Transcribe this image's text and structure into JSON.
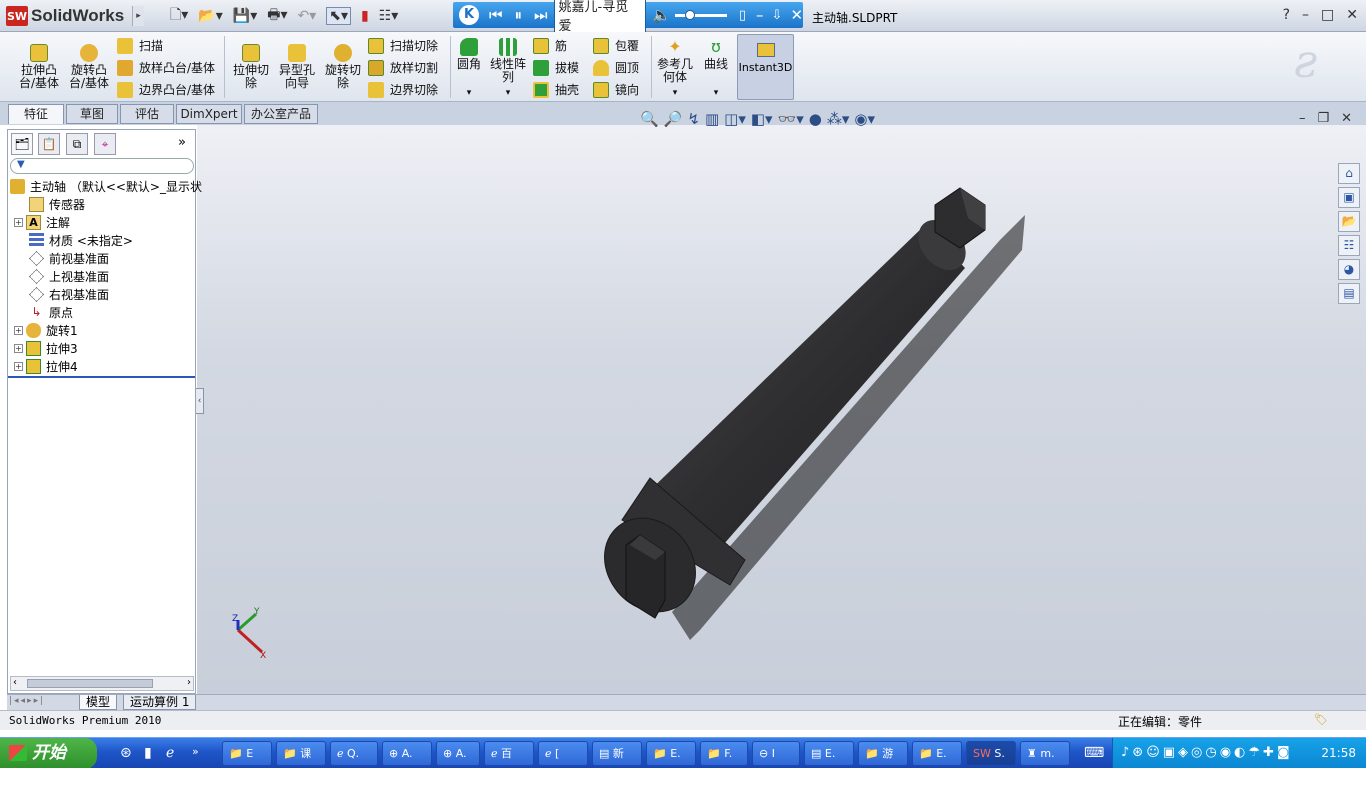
{
  "app": {
    "brand_badge": "SW",
    "brand": "SolidWorks",
    "document_title": "主动轴.SLDPRT",
    "help": "?",
    "min": "–",
    "max": "□",
    "close": "✕"
  },
  "media": {
    "song": "姚嘉儿-寻觅爱",
    "logo": "K",
    "prev": "⏮",
    "pause": "⏸",
    "next": "⏭"
  },
  "ribbon": {
    "extrude_boss": "拉伸凸台/基体",
    "revolve_boss": "旋转凸台/基体",
    "sweep": "扫描",
    "loft_boss": "放样凸台/基体",
    "boundary_boss": "边界凸台/基体",
    "extrude_cut": "拉伸切除",
    "hole_wizard": "异型孔向导",
    "revolve_cut": "旋转切除",
    "sweep_cut": "扫描切除",
    "loft_cut": "放样切割",
    "boundary_cut": "边界切除",
    "fillet": "圆角",
    "linear_pattern": "线性阵列",
    "rib": "筋",
    "draft": "拔模",
    "shell": "抽壳",
    "wrap": "包覆",
    "dome": "圆顶",
    "mirror": "镜向",
    "ref_geometry": "参考几何体",
    "curves": "曲线",
    "instant3d": "Instant3D"
  },
  "tabs": [
    "特征",
    "草图",
    "评估",
    "DimXpert",
    "办公室产品"
  ],
  "tree": {
    "root": "主动轴 （默认<<默认>_显示状",
    "items": [
      "传感器",
      "注解",
      "材质 <未指定>",
      "前视基准面",
      "上视基准面",
      "右视基准面",
      "原点",
      "旋转1",
      "拉伸3",
      "拉伸4"
    ]
  },
  "bottom_tabs": [
    "模型",
    "运动算例 1"
  ],
  "status": {
    "left": "SolidWorks Premium 2010",
    "right": "正在编辑：零件"
  },
  "triad": {
    "x": "X",
    "y": "Y",
    "z": "Z"
  },
  "taskbar": {
    "start": "开始",
    "items": [
      "E",
      "课",
      "Q.",
      "A.",
      "A.",
      "百",
      "[",
      "新",
      "E.",
      "F.",
      "I",
      "E.",
      "游",
      "E.",
      "S.",
      "m."
    ],
    "clock": "21:58"
  }
}
